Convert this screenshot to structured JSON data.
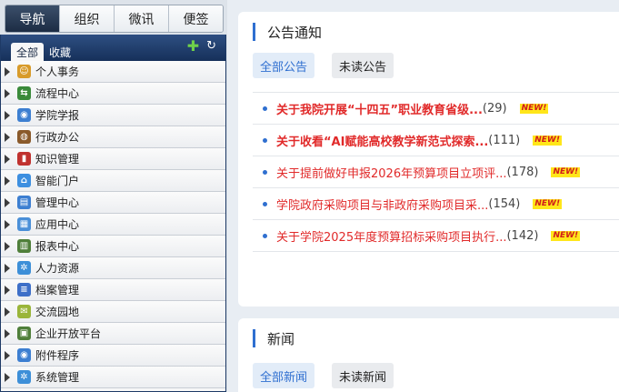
{
  "nav": {
    "top_tabs": [
      "导航",
      "组织",
      "微讯",
      "便签"
    ],
    "sub_tabs": [
      "全部",
      "收藏"
    ],
    "items": [
      {
        "label": "个人事务",
        "icon": "people-icon",
        "color": "#d89b2a"
      },
      {
        "label": "流程中心",
        "icon": "workflow-icon",
        "color": "#3a8a3a"
      },
      {
        "label": "学院学报",
        "icon": "journal-icon",
        "color": "#3d7fd1"
      },
      {
        "label": "行政办公",
        "icon": "office-icon",
        "color": "#8a5a2b"
      },
      {
        "label": "知识管理",
        "icon": "book-icon",
        "color": "#c0322f"
      },
      {
        "label": "智能门户",
        "icon": "home-icon",
        "color": "#3d8fe0"
      },
      {
        "label": "管理中心",
        "icon": "management-icon",
        "color": "#3d7fd1"
      },
      {
        "label": "应用中心",
        "icon": "apps-icon",
        "color": "#4a8fd8"
      },
      {
        "label": "报表中心",
        "icon": "report-icon",
        "color": "#4f7f3a"
      },
      {
        "label": "人力资源",
        "icon": "gear-icon",
        "color": "#3d8fd8"
      },
      {
        "label": "档案管理",
        "icon": "archive-icon",
        "color": "#3d6fc8"
      },
      {
        "label": "交流园地",
        "icon": "chat-icon",
        "color": "#9ab53a"
      },
      {
        "label": "企业开放平台",
        "icon": "platform-icon",
        "color": "#4f7f3a"
      },
      {
        "label": "附件程序",
        "icon": "attachment-icon",
        "color": "#3d7fd1"
      },
      {
        "label": "系统管理",
        "icon": "settings-icon",
        "color": "#3d8fd8"
      }
    ]
  },
  "announcements": {
    "title": "公告通知",
    "tab_all": "全部公告",
    "tab_unread": "未读公告",
    "items": [
      {
        "title": "关于我院开展“十四五”职业教育省级...",
        "count": "(29)",
        "bold": true
      },
      {
        "title": "关于收看“AI赋能高校教学新范式探索...",
        "count": "(111)",
        "bold": true
      },
      {
        "title": "关于提前做好申报2026年预算项目立项评...",
        "count": "(178)",
        "bold": false
      },
      {
        "title": "学院政府采购项目与非政府采购项目采...",
        "count": "(154)",
        "bold": false
      },
      {
        "title": "关于学院2025年度预算招标采购项目执行...",
        "count": "(142)",
        "bold": false
      }
    ],
    "new_label": "NEW!"
  },
  "news": {
    "title": "新闻",
    "tab_all": "全部新闻",
    "tab_unread": "未读新闻"
  }
}
